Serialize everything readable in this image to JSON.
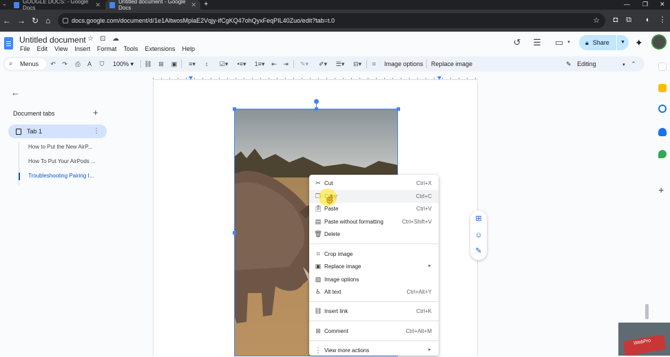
{
  "browser": {
    "tabs": [
      {
        "title": "GOOGLE DOCS: - Google Docs",
        "active": false
      },
      {
        "title": "Untitled document - Google Docs",
        "active": true
      }
    ],
    "url": "docs.google.com/document/d/1e1AltwosMplaE2Vqjy-ifCgKQ47ohQyxFeqPIL40Zuo/edit?tab=t.0"
  },
  "doc": {
    "title": "Untitled document",
    "menus": [
      "File",
      "Edit",
      "View",
      "Insert",
      "Format",
      "Tools",
      "Extensions",
      "Help"
    ],
    "share_label": "Share"
  },
  "toolbar": {
    "menus_label": "Menus",
    "zoom": "100%",
    "image_options": "Image options",
    "replace_image": "Replace image",
    "mode": "Editing"
  },
  "sidepanel": {
    "heading": "Document tabs",
    "tab_label": "Tab 1",
    "outline": [
      "How to Put the New AirP...",
      "How To Put Your AirPods ...",
      "Troubleshooting Pairing I..."
    ]
  },
  "context_menu": [
    {
      "label": "Cut",
      "shortcut": "Ctrl+X",
      "icon": "scissors-icon"
    },
    {
      "label": "Copy",
      "shortcut": "Ctrl+C",
      "icon": "copy-icon"
    },
    {
      "label": "Paste",
      "shortcut": "Ctrl+V",
      "icon": "paste-icon"
    },
    {
      "label": "Paste without formatting",
      "shortcut": "Ctrl+Shift+V",
      "icon": "paste-plain-icon"
    },
    {
      "label": "Delete",
      "shortcut": "",
      "icon": "trash-icon"
    },
    {
      "label": "Crop image",
      "shortcut": "",
      "icon": "crop-icon"
    },
    {
      "label": "Replace image",
      "shortcut": "",
      "icon": "image-icon"
    },
    {
      "label": "Image options",
      "shortcut": "",
      "icon": "image-options-icon"
    },
    {
      "label": "Alt text",
      "shortcut": "Ctrl+Alt+Y",
      "icon": "accessibility-icon"
    },
    {
      "label": "Insert link",
      "shortcut": "Ctrl+K",
      "icon": "link-icon"
    },
    {
      "label": "Comment",
      "shortcut": "Ctrl+Alt+M",
      "icon": "comment-icon"
    },
    {
      "label": "View more actions",
      "shortcut": "",
      "icon": "more-vert-icon"
    }
  ],
  "watermark": "WebPro",
  "colors": {
    "accent": "#0b57d0",
    "share_bg": "#c2e7ff",
    "active_tab_bg": "#d3e3fd",
    "selection": "#4285f4",
    "cursor_highlight": "#ffeb3b"
  }
}
